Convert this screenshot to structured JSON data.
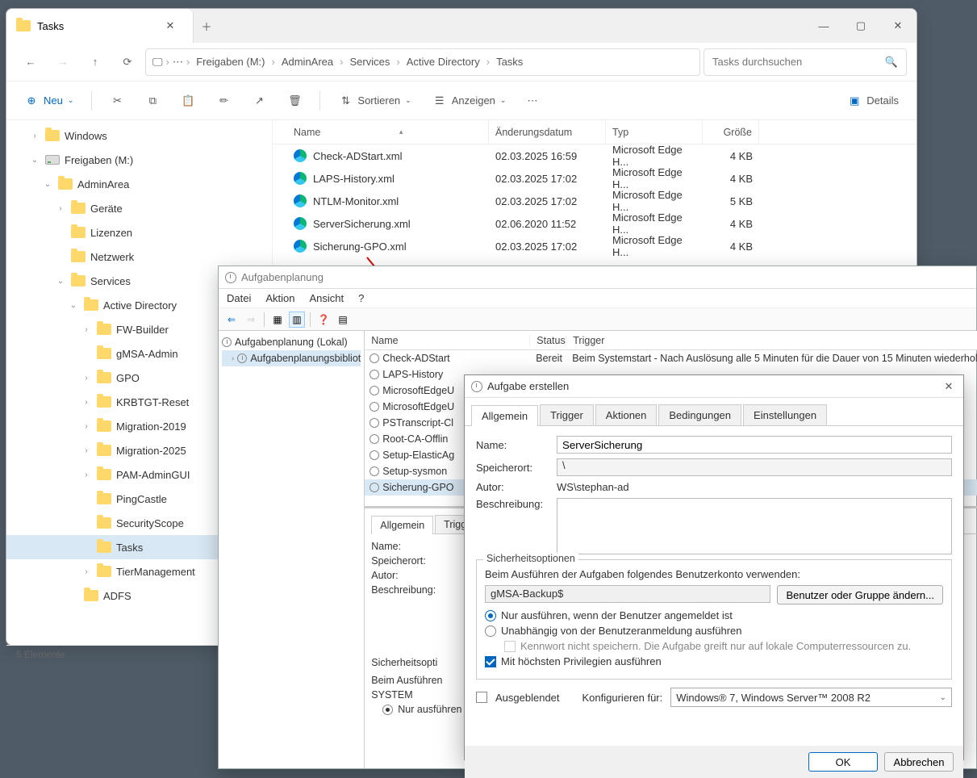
{
  "explorer": {
    "tab_title": "Tasks",
    "breadcrumb": [
      "Freigaben (M:)",
      "AdminArea",
      "Services",
      "Active Directory",
      "Tasks"
    ],
    "search_placeholder": "Tasks durchsuchen",
    "toolbar": {
      "neu": "Neu",
      "sort": "Sortieren",
      "view": "Anzeigen",
      "details": "Details"
    },
    "tree": [
      {
        "label": "Windows",
        "indent": 1,
        "chev": "›",
        "icon": "folder"
      },
      {
        "label": "Freigaben (M:)",
        "indent": 1,
        "chev": "⌄",
        "icon": "drive"
      },
      {
        "label": "AdminArea",
        "indent": 2,
        "chev": "⌄",
        "icon": "folder"
      },
      {
        "label": "Geräte",
        "indent": 3,
        "chev": "›",
        "icon": "folder"
      },
      {
        "label": "Lizenzen",
        "indent": 3,
        "chev": "",
        "icon": "folder"
      },
      {
        "label": "Netzwerk",
        "indent": 3,
        "chev": "",
        "icon": "folder"
      },
      {
        "label": "Services",
        "indent": 3,
        "chev": "⌄",
        "icon": "folder"
      },
      {
        "label": "Active Directory",
        "indent": 4,
        "chev": "⌄",
        "icon": "folder"
      },
      {
        "label": "FW-Builder",
        "indent": 5,
        "chev": "›",
        "icon": "folder"
      },
      {
        "label": "gMSA-Admin",
        "indent": 5,
        "chev": "",
        "icon": "folder"
      },
      {
        "label": "GPO",
        "indent": 5,
        "chev": "›",
        "icon": "folder"
      },
      {
        "label": "KRBTGT-Reset",
        "indent": 5,
        "chev": "›",
        "icon": "folder"
      },
      {
        "label": "Migration-2019",
        "indent": 5,
        "chev": "›",
        "icon": "folder"
      },
      {
        "label": "Migration-2025",
        "indent": 5,
        "chev": "›",
        "icon": "folder"
      },
      {
        "label": "PAM-AdminGUI",
        "indent": 5,
        "chev": "›",
        "icon": "folder"
      },
      {
        "label": "PingCastle",
        "indent": 5,
        "chev": "",
        "icon": "folder"
      },
      {
        "label": "SecurityScope",
        "indent": 5,
        "chev": "",
        "icon": "folder"
      },
      {
        "label": "Tasks",
        "indent": 5,
        "chev": "",
        "icon": "folder",
        "selected": true
      },
      {
        "label": "TierManagement",
        "indent": 5,
        "chev": "›",
        "icon": "folder"
      },
      {
        "label": "ADFS",
        "indent": 4,
        "chev": "",
        "icon": "folder"
      }
    ],
    "columns": {
      "name": "Name",
      "date": "Änderungsdatum",
      "type": "Typ",
      "size": "Größe"
    },
    "files": [
      {
        "name": "Check-ADStart.xml",
        "date": "02.03.2025 16:59",
        "type": "Microsoft Edge H...",
        "size": "4 KB"
      },
      {
        "name": "LAPS-History.xml",
        "date": "02.03.2025 17:02",
        "type": "Microsoft Edge H...",
        "size": "4 KB"
      },
      {
        "name": "NTLM-Monitor.xml",
        "date": "02.03.2025 17:02",
        "type": "Microsoft Edge H...",
        "size": "5 KB"
      },
      {
        "name": "ServerSicherung.xml",
        "date": "02.06.2020 11:52",
        "type": "Microsoft Edge H...",
        "size": "4 KB"
      },
      {
        "name": "Sicherung-GPO.xml",
        "date": "02.03.2025 17:02",
        "type": "Microsoft Edge H...",
        "size": "4 KB"
      }
    ],
    "status": "5 Elemente"
  },
  "scheduler": {
    "title": "Aufgabenplanung",
    "menu": [
      "Datei",
      "Aktion",
      "Ansicht",
      "?"
    ],
    "tree_root": "Aufgabenplanung (Lokal)",
    "tree_lib": "Aufgabenplanungsbibliot",
    "cols": {
      "name": "Name",
      "status": "Status",
      "trigger": "Trigger"
    },
    "tasks": [
      {
        "name": "Check-ADStart",
        "status": "Bereit",
        "trigger": "Beim Systemstart - Nach Auslösung alle 5 Minuten für die Dauer von 15 Minuten wiederhol..."
      },
      {
        "name": "LAPS-History"
      },
      {
        "name": "MicrosoftEdgeU"
      },
      {
        "name": "MicrosoftEdgeU"
      },
      {
        "name": "PSTranscript-Cl"
      },
      {
        "name": "Root-CA-Offlin"
      },
      {
        "name": "Setup-ElasticAg"
      },
      {
        "name": "Setup-sysmon"
      },
      {
        "name": "Sicherung-GPO",
        "selected": true
      }
    ],
    "detail_tabs": [
      "Allgemein",
      "Trigge"
    ],
    "detail": {
      "name_lbl": "Name:",
      "loc_lbl": "Speicherort:",
      "author_lbl": "Autor:",
      "desc_lbl": "Beschreibung:",
      "sec_title": "Sicherheitsopti",
      "sec_line": "Beim Ausführen",
      "sec_user": "SYSTEM",
      "radio1": "Nur ausführen"
    }
  },
  "dialog": {
    "title": "Aufgabe erstellen",
    "tabs": [
      "Allgemein",
      "Trigger",
      "Aktionen",
      "Bedingungen",
      "Einstellungen"
    ],
    "name_lbl": "Name:",
    "name_val": "ServerSicherung",
    "loc_lbl": "Speicherort:",
    "loc_val": "\\",
    "author_lbl": "Autor:",
    "author_val": "WS\\stephan-ad",
    "desc_lbl": "Beschreibung:",
    "sec_title": "Sicherheitsoptionen",
    "sec_text": "Beim Ausführen der Aufgaben folgendes Benutzerkonto verwenden:",
    "user": "gMSA-Backup$",
    "change_btn": "Benutzer oder Gruppe ändern...",
    "radio_logged": "Nur ausführen, wenn der Benutzer angemeldet ist",
    "radio_any": "Unabhängig von der Benutzeranmeldung ausführen",
    "check_nopw": "Kennwort nicht speichern. Die Aufgabe greift nur auf lokale Computerressourcen zu.",
    "check_priv": "Mit höchsten Privilegien ausführen",
    "check_hidden": "Ausgeblendet",
    "config_lbl": "Konfigurieren für:",
    "config_val": "Windows® 7, Windows Server™ 2008 R2",
    "ok": "OK",
    "cancel": "Abbrechen"
  }
}
